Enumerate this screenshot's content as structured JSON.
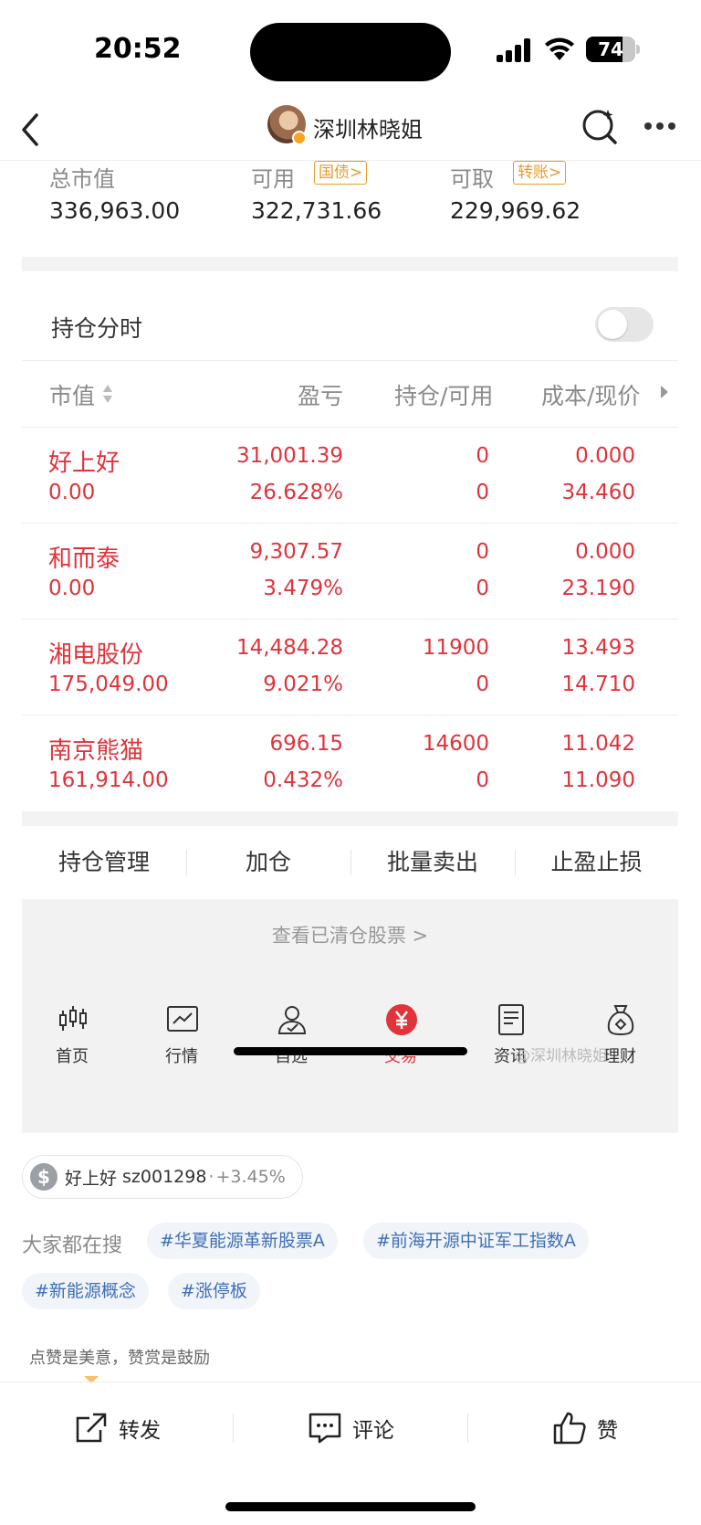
{
  "status_bar": {
    "time": "20:52",
    "battery": "74",
    "battery_level": 0.74
  },
  "header": {
    "title": "深圳林晓姐"
  },
  "summary": {
    "total_label": "总市值",
    "total_value": "336,963.00",
    "available_label": "可用",
    "available_tag": "国债>",
    "available_value": "322,731.66",
    "withdrawable_label": "可取",
    "withdrawable_tag": "转账>",
    "withdrawable_value": "229,969.62"
  },
  "toggle": {
    "label": "持仓分时",
    "on": false
  },
  "table": {
    "headers": [
      "市值",
      "盈亏",
      "持仓/可用",
      "成本/现价"
    ],
    "rows": [
      {
        "name": "好上好",
        "market_value": "0.00",
        "pnl": "31,001.39",
        "pnl_pct": "26.628%",
        "position": "0",
        "available": "0",
        "cost": "0.000",
        "price": "34.460"
      },
      {
        "name": "和而泰",
        "market_value": "0.00",
        "pnl": "9,307.57",
        "pnl_pct": "3.479%",
        "position": "0",
        "available": "0",
        "cost": "0.000",
        "price": "23.190"
      },
      {
        "name": "湘电股份",
        "market_value": "175,049.00",
        "pnl": "14,484.28",
        "pnl_pct": "9.021%",
        "position": "11900",
        "available": "0",
        "cost": "13.493",
        "price": "14.710"
      },
      {
        "name": "南京熊猫",
        "market_value": "161,914.00",
        "pnl": "696.15",
        "pnl_pct": "0.432%",
        "position": "14600",
        "available": "0",
        "cost": "11.042",
        "price": "11.090"
      }
    ]
  },
  "actions": [
    "持仓管理",
    "加仓",
    "批量卖出",
    "止盈止损"
  ],
  "cleared_link": "查看已清仓股票 >",
  "tabs": [
    {
      "label": "首页",
      "icon": "candlestick-icon",
      "active": false
    },
    {
      "label": "行情",
      "icon": "chart-icon",
      "active": false
    },
    {
      "label": "自选",
      "icon": "person-check-icon",
      "active": false
    },
    {
      "label": "交易",
      "icon": "yuan-icon",
      "active": true
    },
    {
      "label": "资讯",
      "icon": "document-icon",
      "active": false
    },
    {
      "label": "理财",
      "icon": "money-bag-icon",
      "active": false
    }
  ],
  "watermark": "@深圳林晓姐",
  "stock_chip": {
    "name": "好上好",
    "code": "sz001298",
    "change": "+3.45%"
  },
  "topics": {
    "label": "大家都在搜",
    "items": [
      "#华夏能源革新股票A",
      "#前海开源中证军工指数A",
      "#新能源概念",
      "#涨停板"
    ]
  },
  "reward_text": "点赞是美意，赞赏是鼓励",
  "bottom_bar": {
    "share": "转发",
    "comment": "评论",
    "like": "赞"
  },
  "colors": {
    "red": "#e0333b",
    "gold": "#e39d2d",
    "topic_blue": "#3f6fb5"
  }
}
